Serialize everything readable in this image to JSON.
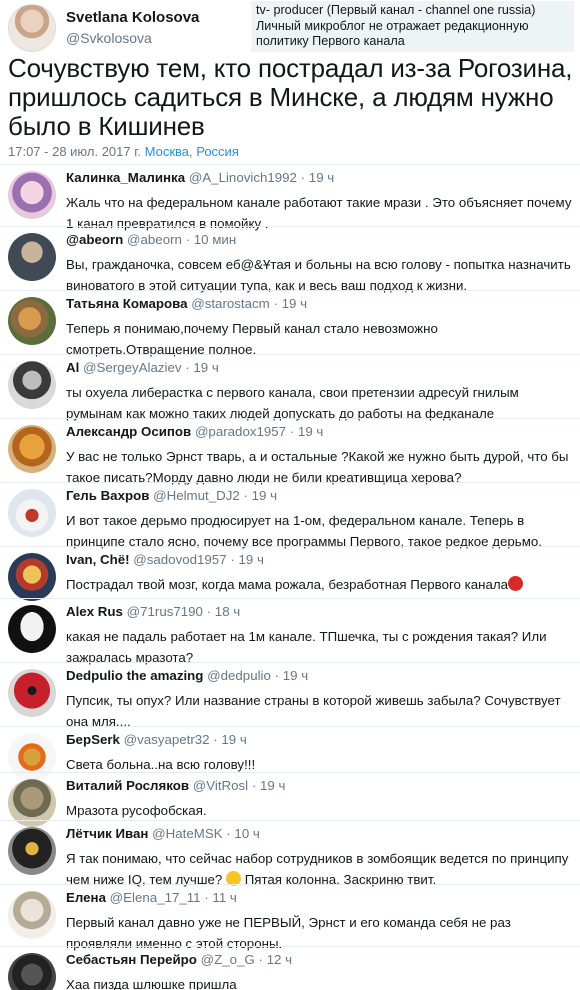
{
  "tweet": {
    "author_name": "Svetlana Kolosova",
    "author_handle": "@Svkolosova",
    "bio": "tv- producer (Первый канал - channel one russia) Личный микроблог не отражает редакционную политику Первого канала",
    "text": "Сочувствую тем, кто пострадал из-за Рогозина, пришлось садиться в Минске, а людям нужно было в Кишинев",
    "timestamp": "17:07 - 28 июл. 2017 г.",
    "location": "Москва, Россия"
  },
  "replies": [
    {
      "name": "Калинка_Малинка",
      "handle": "@A_Linovich1992",
      "sep": "·",
      "time": "19 ч",
      "text": "Жаль что на федеральном канале работают такие мрази .  Это объясняет почему 1 канал превратился в помойку ."
    },
    {
      "name": "@abeorn",
      "handle": "@abeorn",
      "sep": "·",
      "time": "10 мин",
      "text": "Вы, гражданочка, совсем еб@&Ұтая и больны на всю голову - попытка назначить виноватого в этой ситуации тупа, как и весь ваш подход к жизни."
    },
    {
      "name": "Татьяна Комарова",
      "handle": "@starostacm",
      "sep": "·",
      "time": "19 ч",
      "text": "Теперь я понимаю,почему Первый канал стало невозможно смотреть.Отвращение полное."
    },
    {
      "name": "Al",
      "handle": "@SergeyAlaziev",
      "sep": "·",
      "time": "19 ч",
      "text": "ты охуела либерастка с первого канала, свои претензии адресуй гнилым румынам как можно таких людей допускать до работы на федканале"
    },
    {
      "name": "Александр Осипов",
      "handle": "@paradox1957",
      "sep": "·",
      "time": "19 ч",
      "text": "У вас не только Эрнст тварь, а и остальные ?Какой же нужно быть дурой, что бы такое писать?Морду давно люди не били креативщица херова?"
    },
    {
      "name": "Гель Вахров",
      "handle": "@Helmut_DJ2",
      "sep": "·",
      "time": "19 ч",
      "text": "И вот такое дерьмо продюсирует на 1-ом, федеральном канале. Теперь в принципе стало ясно, почему все программы Первого, такое редкое дерьмо."
    },
    {
      "name": "Ivan, Chë!",
      "handle": "@sadovod1957",
      "sep": "·",
      "time": "19 ч",
      "text": "Пострадал твой мозг, когда мама рожала, безработная Первого канала"
    },
    {
      "name": "Alex Rus",
      "handle": "@71rus7190",
      "sep": "·",
      "time": "18 ч",
      "text": "какая не падаль работает на 1м канале. ТПшечка, ты с рождения такая? Или зажралась мразота?"
    },
    {
      "name": "Dedpulio the amazing",
      "handle": "@dedpulio",
      "sep": "·",
      "time": "19 ч",
      "text": "Пупсик, ты опух? Или название страны в которой живешь забыла? Сочувствует она мля...."
    },
    {
      "name": "БерSerk",
      "handle": "@vasyapetr32",
      "sep": "·",
      "time": "19 ч",
      "text": "Света больна..на всю голову!!!"
    },
    {
      "name": "Виталий Росляков",
      "handle": "@VitRosl",
      "sep": "·",
      "time": "19 ч",
      "text": "Мразота русофобская."
    },
    {
      "name": "Лётчик Иван",
      "handle": "@HateMSK",
      "sep": "·",
      "time": "10 ч",
      "text": "Я так понимаю, что сейчас набор сотрудников в зомбоящик ведется по принципу чем ниже IQ, тем лучше?",
      "text_after": " Пятая колонна. Заскриню твит."
    },
    {
      "name": "Елена",
      "handle": "@Elena_17_11",
      "sep": "·",
      "time": "11 ч",
      "text": "Первый канал давно уже не ПЕРВЫЙ,  Эрнст и его команда себя не раз проявляли именно с этой стороны."
    },
    {
      "name": "Себастьян Перейро",
      "handle": "@Z_o_G",
      "sep": "·",
      "time": "12 ч",
      "text": "Хаа пизда шлюшке пришла"
    }
  ]
}
